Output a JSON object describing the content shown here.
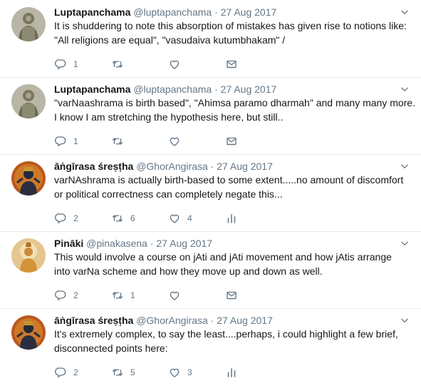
{
  "tweets": [
    {
      "name": "Luptapanchama",
      "handle": "@luptapanchama",
      "date": "27 Aug 2017",
      "avatar": "temple-statue",
      "lines": [
        "It is shuddering to note this absorption of mistakes has given rise to notions like:",
        "\"All religions are equal\", \"vasudaiva kutumbhakam\" /"
      ],
      "replies": "1",
      "retweets": "",
      "likes": "",
      "last_icon": "envelope-icon"
    },
    {
      "name": "Luptapanchama",
      "handle": "@luptapanchama",
      "date": "27 Aug 2017",
      "avatar": "temple-statue",
      "lines": [
        "\"varNaashrama is birth based\", \"Ahimsa paramo dharmah\" and many many more.",
        "I know I am stretching the hypothesis here, but still.."
      ],
      "replies": "1",
      "retweets": "",
      "likes": "",
      "last_icon": "envelope-icon"
    },
    {
      "name": "āṅgīrasa śreṣṭha",
      "handle": "@GhorAngirasa",
      "date": "27 Aug 2017",
      "avatar": "deity-dark",
      "lines": [
        "varNAshrama is actually birth-based to some extent.....no amount of discomfort",
        "or political correctness can completely negate this..."
      ],
      "replies": "2",
      "retweets": "6",
      "likes": "4",
      "last_icon": "analytics-icon"
    },
    {
      "name": "Pināki",
      "handle": "@pinakasena",
      "date": "27 Aug 2017",
      "avatar": "deity-golden",
      "lines": [
        "This would involve a course on jAti and jAti movement and how jAtis arrange",
        "into varNa scheme and how they move up and down as well."
      ],
      "replies": "2",
      "retweets": "1",
      "likes": "",
      "last_icon": "envelope-icon"
    },
    {
      "name": "āṅgīrasa śreṣṭha",
      "handle": "@GhorAngirasa",
      "date": "27 Aug 2017",
      "avatar": "deity-dark",
      "lines": [
        "It's extremely complex, to say the least....perhaps, i could highlight a few brief,",
        "disconnected points here:"
      ],
      "replies": "2",
      "retweets": "5",
      "likes": "3",
      "last_icon": "analytics-icon"
    }
  ],
  "colors": {
    "text": "#14171a",
    "muted": "#657786",
    "divider": "#e6ecf0"
  }
}
